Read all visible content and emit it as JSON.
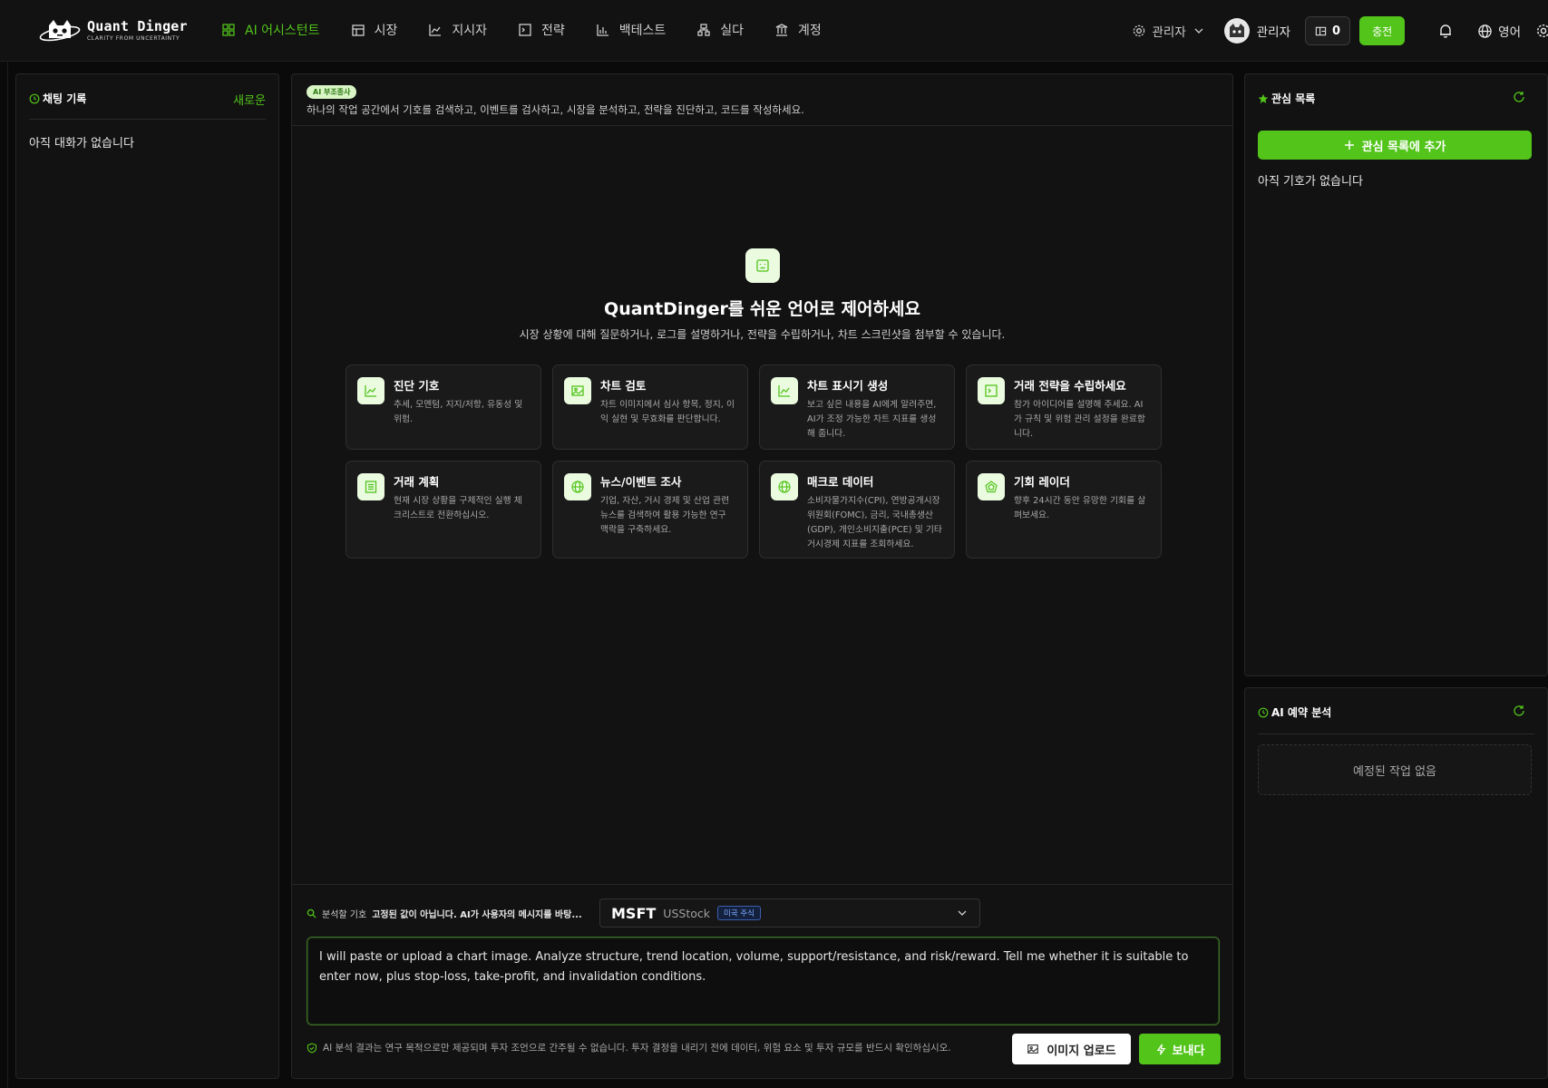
{
  "brand": {
    "name": "Quant Dinger",
    "tagline": "CLARITY FROM UNCERTAINTY"
  },
  "nav": [
    {
      "label": "AI 어시스턴트",
      "icon": "grid-icon",
      "active": true
    },
    {
      "label": "시장",
      "icon": "calendar-icon",
      "active": false
    },
    {
      "label": "지시자",
      "icon": "line-chart-icon",
      "active": false
    },
    {
      "label": "전략",
      "icon": "terminal-icon",
      "active": false
    },
    {
      "label": "백테스트",
      "icon": "bar-chart-icon",
      "active": false
    },
    {
      "label": "실다",
      "icon": "sitemap-icon",
      "active": false
    },
    {
      "label": "계정",
      "icon": "bank-icon",
      "active": false
    }
  ],
  "topRight": {
    "adminMenu": "관리자",
    "userName": "관리자",
    "credits": "0",
    "recharge": "충전",
    "language": "영어"
  },
  "chatHistory": {
    "title": "채팅 기록",
    "newLabel": "새로운",
    "empty": "아직 대화가 없습니다"
  },
  "workspace": {
    "badge": "AI 부조종사",
    "description": "하나의 작업 공간에서 기호를 검색하고, 이벤트를 검사하고, 시장을 분석하고, 전략을 진단하고, 코드를 작성하세요.",
    "heroTitle": "QuantDinger를 쉬운 언어로 제어하세요",
    "heroSub": "시장 상황에 대해 질문하거나, 로그를 설명하거나, 전략을 수립하거나, 차트 스크린샷을 첨부할 수 있습니다.",
    "cards": [
      {
        "title": "진단 기호",
        "desc": "추세, 모멘텀, 지지/저항, 유동성 및 위험.",
        "icon": "line-chart-icon"
      },
      {
        "title": "차트 검토",
        "desc": "차트 이미지에서 심사 항목, 정지, 이익 실현 및 무효화를 판단합니다.",
        "icon": "image-icon"
      },
      {
        "title": "차트 표시기 생성",
        "desc": "보고 싶은 내용을 AI에게 알려주면, AI가 조정 가능한 차트 지표를 생성해 줍니다.",
        "icon": "line-chart-icon"
      },
      {
        "title": "거래 전략을 수립하세요",
        "desc": "참가 아이디어를 설명해 주세요. AI가 규칙 및 위험 관리 설정을 완료합니다.",
        "icon": "terminal-icon"
      },
      {
        "title": "거래 계획",
        "desc": "현재 시장 상황을 구체적인 실행 체크리스트로 전환하십시오.",
        "icon": "list-icon"
      },
      {
        "title": "뉴스/이벤트 조사",
        "desc": "기업, 자산, 거시 경제 및 산업 관련 뉴스를 검색하여 활용 가능한 연구 맥락을 구축하세요.",
        "icon": "globe-icon"
      },
      {
        "title": "매크로 데이터",
        "desc": "소비자물가지수(CPI), 연방공개시장위원회(FOMC), 금리, 국내총생산(GDP), 개인소비지출(PCE) 및 기타 거시경제 지표를 조회하세요.",
        "icon": "globe-icon"
      },
      {
        "title": "기회 레이더",
        "desc": "향후 24시간 동안 유망한 기회를 살펴보세요.",
        "icon": "radar-icon"
      }
    ],
    "symbolLabel": "분석할 기호",
    "symbolHint": "고정된 값이 아닙니다. AI가 사용자의 메시지를 바탕...",
    "symbol": {
      "code": "MSFT",
      "market": "USStock",
      "tag": "미국 주식"
    },
    "prompt": "I will paste or upload a chart image. Analyze structure, trend location, volume, support/resistance, and risk/reward. Tell me whether it is suitable to enter now, plus stop-loss, take-profit, and invalidation conditions.",
    "disclaimer": "AI 분석 결과는 연구 목적으로만 제공되며 투자 조언으로 간주될 수 없습니다. 투자 결정을 내리기 전에 데이터, 위험 요소 및 투자 규모를 반드시 확인하십시오.",
    "uploadLabel": "이미지 업로드",
    "sendLabel": "보내다"
  },
  "watchlist": {
    "title": "관심 목록",
    "addLabel": "관심 목록에 추가",
    "empty": "아직 기호가 없습니다"
  },
  "scheduled": {
    "title": "AI 예약 분석",
    "empty": "예정된 작업 없음"
  },
  "colors": {
    "accent": "#52c41a",
    "background": "#0a0a0a",
    "panel": "#121212"
  }
}
